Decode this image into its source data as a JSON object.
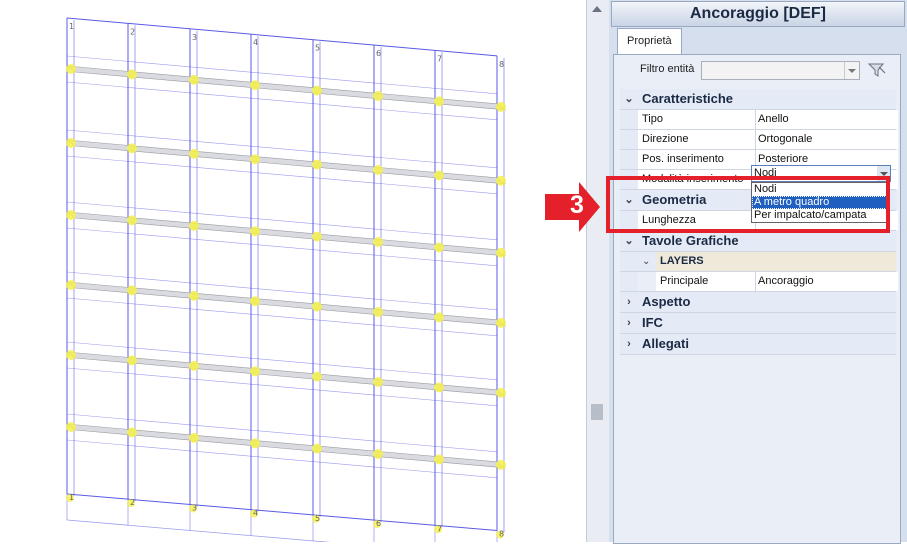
{
  "panel": {
    "title": "Ancoraggio [DEF]",
    "tab_properties": "Proprietà",
    "filter_label": "Filtro entità",
    "filter_value": ""
  },
  "categories": {
    "caratteristiche": "Caratteristiche",
    "geometria": "Geometria",
    "tavole_grafiche": "Tavole Grafiche",
    "layers": "LAYERS",
    "aspetto": "Aspetto",
    "ifc": "IFC",
    "allegati": "Allegati"
  },
  "properties": {
    "tipo": {
      "name": "Tipo",
      "value": "Anello"
    },
    "direzione": {
      "name": "Direzione",
      "value": "Ortogonale"
    },
    "pos_inserimento": {
      "name": "Pos. inserimento",
      "value": "Posteriore"
    },
    "modalita_inserimento": {
      "name": "Modalità inserimento",
      "value": "Nodi"
    },
    "lunghezza": {
      "name": "Lunghezza",
      "value": ""
    },
    "principale": {
      "name": "Principale",
      "value": "Ancoraggio"
    }
  },
  "dropdown_options": [
    "Nodi",
    "A metro quadro",
    "Per impalcato/campata"
  ],
  "dropdown_selected_index": 1,
  "callout_number": "3",
  "scaffold_top_labels": [
    "1",
    "2",
    "3",
    "4",
    "5",
    "6",
    "7",
    "8"
  ],
  "scaffold_bottom_labels": [
    "1",
    "2",
    "3",
    "4",
    "5",
    "6",
    "7",
    "8"
  ],
  "colors": {
    "accent_red": "#e4202b",
    "selection_blue": "#1f5fbf",
    "wireframe": "#5a5ae6",
    "anchor_yellow": "#f5f04a"
  }
}
